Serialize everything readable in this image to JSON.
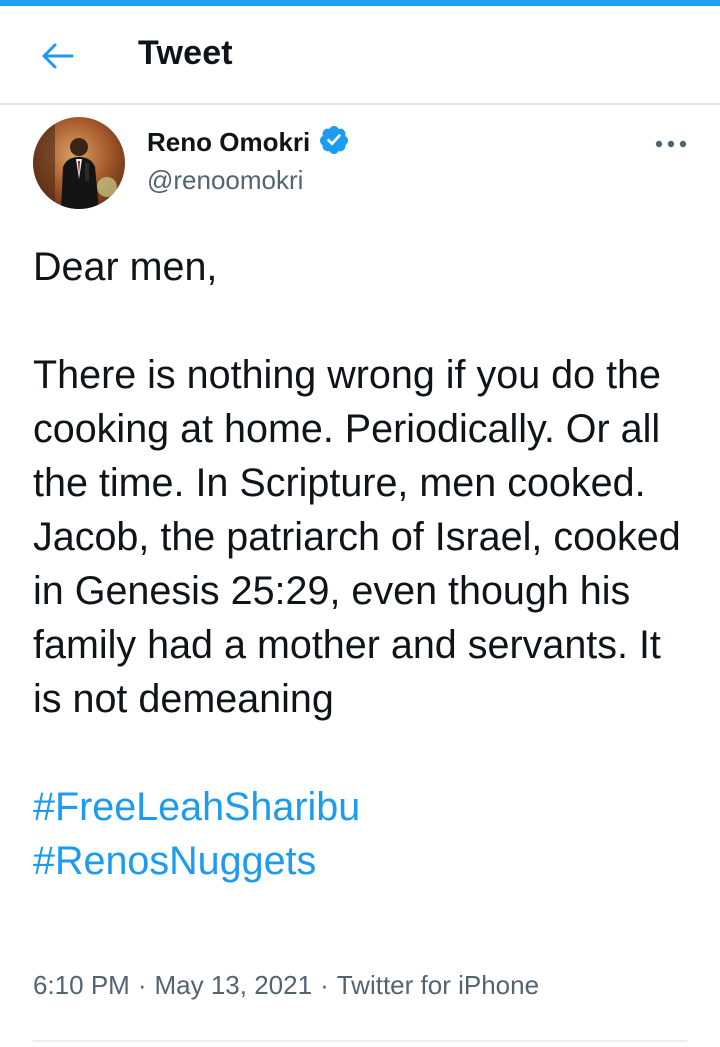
{
  "header": {
    "title": "Tweet",
    "back_icon": "arrow-left-icon"
  },
  "author": {
    "display_name": "Reno Omokri",
    "handle": "@renoomokri",
    "verified_icon": "verified-badge-icon",
    "more_icon": "more-horizontal-icon"
  },
  "tweet": {
    "paragraphs": [
      "Dear men,",
      "There is nothing wrong if you do the cooking at home. Periodically. Or all the time. In Scripture, men cooked. Jacob, the patriarch of Israel, cooked in Genesis 25:29, even though his family had a mother and servants. It is not demeaning"
    ],
    "hashtags": [
      "#FreeLeahSharibu",
      "#RenosNuggets"
    ],
    "time": "6:10 PM",
    "date": "May 13, 2021",
    "source": "Twitter for iPhone",
    "separator": "·"
  },
  "colors": {
    "accent": "#1d9bf0",
    "text": "#0f1419",
    "muted": "#536471"
  }
}
